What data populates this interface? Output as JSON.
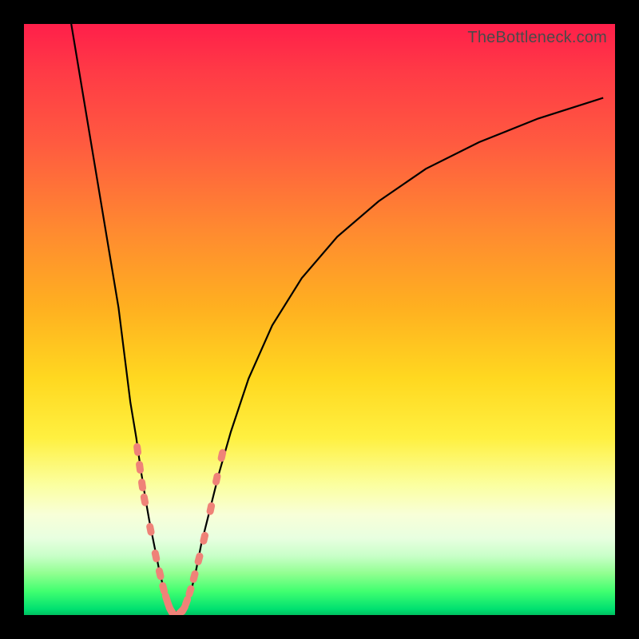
{
  "watermark": "TheBottleneck.com",
  "chart_data": {
    "type": "line",
    "title": "",
    "xlabel": "",
    "ylabel": "",
    "xlim": [
      0,
      100
    ],
    "ylim": [
      0,
      100
    ],
    "curve_left": {
      "x": [
        8,
        10,
        12,
        14,
        16,
        17,
        18,
        19,
        19.7,
        20.5,
        21.2,
        22,
        22.8,
        23.5,
        24.2,
        25
      ],
      "y": [
        100,
        88,
        76,
        64,
        52,
        44,
        36,
        30,
        25,
        20,
        16,
        12,
        8,
        5,
        2.5,
        0.5
      ]
    },
    "curve_right": {
      "x": [
        27,
        28,
        29,
        30,
        31.5,
        33,
        35,
        38,
        42,
        47,
        53,
        60,
        68,
        77,
        87,
        98
      ],
      "y": [
        0.5,
        3,
        7,
        12,
        18,
        24,
        31,
        40,
        49,
        57,
        64,
        70,
        75.5,
        80,
        84,
        87.5
      ]
    },
    "flat_bottom": {
      "x": [
        25,
        27
      ],
      "y": [
        0.5,
        0.5
      ]
    },
    "markers_left": {
      "x": [
        19.2,
        19.6,
        20.0,
        20.4,
        21.4,
        22.3,
        23.0,
        23.6,
        24.1,
        24.5,
        24.8,
        25.0
      ],
      "y": [
        28,
        25,
        22,
        19.5,
        14.5,
        10,
        7,
        4.5,
        2.8,
        1.6,
        0.9,
        0.6
      ]
    },
    "markers_right": {
      "x": [
        26.6,
        27.0,
        27.5,
        28.1,
        28.8,
        29.6,
        30.5,
        31.6,
        32.6,
        33.5
      ],
      "y": [
        0.6,
        1.0,
        2.2,
        4.0,
        6.5,
        9.5,
        13,
        18,
        23,
        27
      ]
    },
    "colors": {
      "curve": "#000000",
      "marker_fill": "#ef8278",
      "marker_stroke": "#ef8278"
    }
  }
}
